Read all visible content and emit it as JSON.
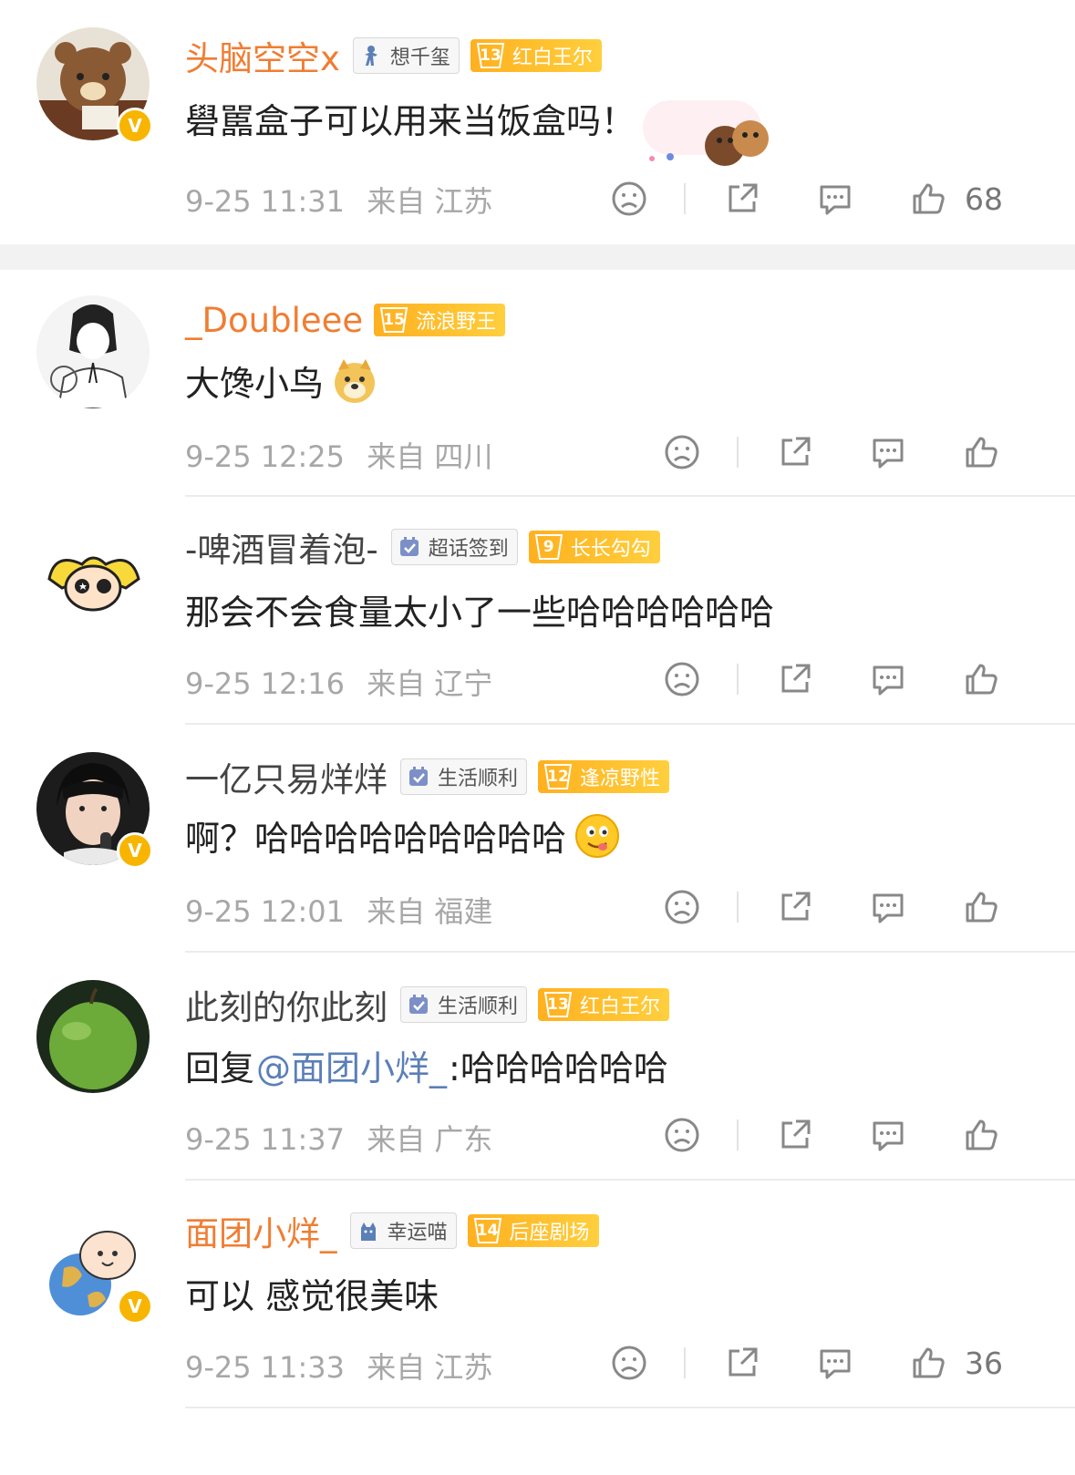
{
  "comments": [
    {
      "username": "头脑空空x",
      "tag": "想千玺",
      "level": "13",
      "level_label": "红白王尔",
      "text": "礐嚚盒子可以用来当饭盒吗！",
      "date": "9-25 11:31",
      "from": "来自",
      "location": "江苏",
      "likes": "68"
    },
    {
      "username": "_Doubleee",
      "level": "15",
      "level_label": "流浪野王",
      "text": "大馋小鸟",
      "date": "9-25 12:25",
      "from": "来自",
      "location": "四川"
    },
    {
      "username": "-啤酒冒着泡-",
      "tag": "超话签到",
      "level": "9",
      "level_label": "长长勾勾",
      "text": "那会不会食量太小了一些哈哈哈哈哈哈",
      "date": "9-25 12:16",
      "from": "来自",
      "location": "辽宁"
    },
    {
      "username": "一亿只易烊烊",
      "tag": "生活顺利",
      "level": "12",
      "level_label": "逢凉野性",
      "text": "啊？哈哈哈哈哈哈哈哈哈",
      "date": "9-25 12:01",
      "from": "来自",
      "location": "福建"
    },
    {
      "username": "此刻的你此刻",
      "tag": "生活顺利",
      "level": "13",
      "level_label": "红白王尔",
      "text_prefix": "回复",
      "mention": "@面团小烊_",
      "text_suffix": ":哈哈哈哈哈哈",
      "date": "9-25 11:37",
      "from": "来自",
      "location": "广东"
    },
    {
      "username": "面团小烊_",
      "tag": "幸运喵",
      "level": "14",
      "level_label": "后座剧场",
      "text": "可以 感觉很美味",
      "date": "9-25 11:33",
      "from": "来自",
      "location": "江苏",
      "likes": "36"
    }
  ],
  "icons": {
    "verified": "V",
    "dislike": "frown-icon",
    "share": "share-icon",
    "comment": "comment-icon",
    "like": "thumbs-up-icon"
  },
  "colors": {
    "vip_name": "#f07d32",
    "mention": "#5b7fb7",
    "level_badge": "#ffb01f",
    "verified": "#f7b500"
  }
}
